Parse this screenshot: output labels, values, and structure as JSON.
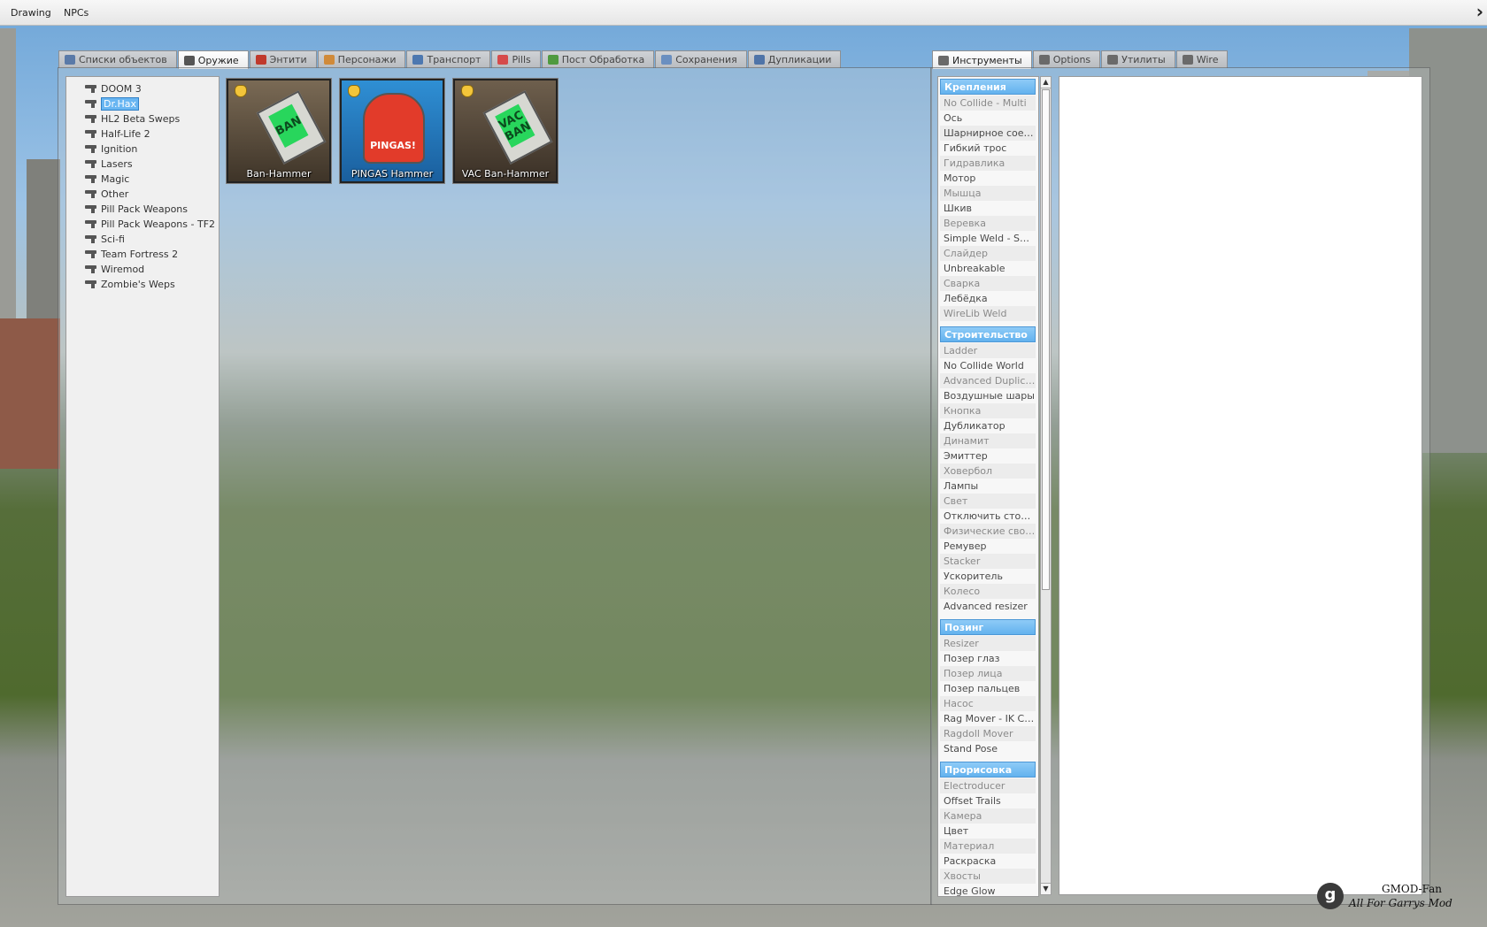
{
  "menubar": {
    "items": [
      "Drawing",
      "NPCs"
    ]
  },
  "spawnmenu": {
    "tabs": [
      {
        "label": "Списки объектов",
        "icon": "grid-icon",
        "color": "#5a7aa8"
      },
      {
        "label": "Оружие",
        "icon": "gun-icon",
        "color": "#555555",
        "active": true
      },
      {
        "label": "Энтити",
        "icon": "entity-icon",
        "color": "#c0392b"
      },
      {
        "label": "Персонажи",
        "icon": "face-icon",
        "color": "#d08a3a"
      },
      {
        "label": "Транспорт",
        "icon": "car-icon",
        "color": "#4d78b0"
      },
      {
        "label": "Pills",
        "icon": "pill-icon",
        "color": "#d64b4b"
      },
      {
        "label": "Пост Обработка",
        "icon": "image-icon",
        "color": "#4f9a3f"
      },
      {
        "label": "Сохранения",
        "icon": "save-icon",
        "color": "#6a8fc0"
      },
      {
        "label": "Дупликации",
        "icon": "dupe-icon",
        "color": "#4f74a8"
      }
    ],
    "categories": [
      "DOOM 3",
      "Dr.Hax",
      "HL2 Beta Sweps",
      "Half-Life 2",
      "Ignition",
      "Lasers",
      "Magic",
      "Other",
      "Pill Pack Weapons",
      "Pill Pack Weapons - TF2",
      "Sci-fi",
      "Team Fortress 2",
      "Wiremod",
      "Zombie's Weps"
    ],
    "selected_category": "Dr.Hax",
    "weapons": [
      {
        "label": "Ban-Hammer",
        "sign": "BAN"
      },
      {
        "label": "PINGAS Hammer",
        "sign": "PINGAS!"
      },
      {
        "label": "VAC Ban-Hammer",
        "sign": "VAC BAN"
      }
    ]
  },
  "toolmenu": {
    "tabs": [
      {
        "label": "Инструменты",
        "icon": "wrench-icon",
        "color": "#6a6a6a",
        "active": true
      },
      {
        "label": "Options",
        "icon": "wrench-icon",
        "color": "#6a6a6a"
      },
      {
        "label": "Утилиты",
        "icon": "document-icon",
        "color": "#6a6a6a"
      },
      {
        "label": "Wire",
        "icon": "wrench-icon",
        "color": "#6a6a6a"
      }
    ],
    "categories": [
      {
        "name": "Крепления",
        "items": [
          {
            "label": "No Collide - Multi",
            "dim": true
          },
          {
            "label": "Ось"
          },
          {
            "label": "Шарнирное соединение"
          },
          {
            "label": "Гибкий трос"
          },
          {
            "label": "Гидравлика",
            "dim": true
          },
          {
            "label": "Мотор"
          },
          {
            "label": "Мышца",
            "dim": true
          },
          {
            "label": "Шкив"
          },
          {
            "label": "Веревка",
            "dim": true
          },
          {
            "label": "Simple Weld - Smart"
          },
          {
            "label": "Слайдер",
            "dim": true
          },
          {
            "label": "Unbreakable"
          },
          {
            "label": "Сварка",
            "dim": true
          },
          {
            "label": "Лебёдка"
          },
          {
            "label": "WireLib Weld",
            "dim": true
          }
        ]
      },
      {
        "name": "Строительство",
        "items": [
          {
            "label": "Ladder",
            "dim": true
          },
          {
            "label": "No Collide World"
          },
          {
            "label": "Advanced Duplicator",
            "dim": true
          },
          {
            "label": "Воздушные шары"
          },
          {
            "label": "Кнопка",
            "dim": true
          },
          {
            "label": "Дубликатор"
          },
          {
            "label": "Динамит",
            "dim": true
          },
          {
            "label": "Эмиттер"
          },
          {
            "label": "Ховербол",
            "dim": true
          },
          {
            "label": "Лампы"
          },
          {
            "label": "Свет",
            "dim": true
          },
          {
            "label": "Отключить столкновения"
          },
          {
            "label": "Физические свойства",
            "dim": true
          },
          {
            "label": "Ремувер"
          },
          {
            "label": "Stacker",
            "dim": true
          },
          {
            "label": "Ускоритель"
          },
          {
            "label": "Колесо",
            "dim": true
          },
          {
            "label": "Advanced resizer"
          }
        ]
      },
      {
        "name": "Позинг",
        "items": [
          {
            "label": "Resizer",
            "dim": true
          },
          {
            "label": "Позер глаз"
          },
          {
            "label": "Позер лица",
            "dim": true
          },
          {
            "label": "Позер пальцев"
          },
          {
            "label": "Насос",
            "dim": true
          },
          {
            "label": "Rag Mover - IK Chains"
          },
          {
            "label": "Ragdoll Mover",
            "dim": true
          },
          {
            "label": "Stand Pose"
          }
        ]
      },
      {
        "name": "Прорисовка",
        "items": [
          {
            "label": "Electroducer",
            "dim": true
          },
          {
            "label": "Offset Trails"
          },
          {
            "label": "Камера",
            "dim": true
          },
          {
            "label": "Цвет"
          },
          {
            "label": "Материал",
            "dim": true
          },
          {
            "label": "Раскраска"
          },
          {
            "label": "Хвосты",
            "dim": true
          },
          {
            "label": "Edge Glow"
          }
        ]
      }
    ]
  },
  "watermark": {
    "logo": "g",
    "title": "GMOD-Fan",
    "subtitle": "All For Garrys Mod"
  }
}
